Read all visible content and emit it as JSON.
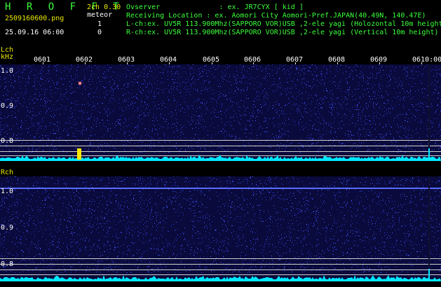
{
  "header": {
    "brand": "H R O F F T",
    "version": "2ch 0.30",
    "file_name": "2509160600.png",
    "datetime": "25.09.16 06:00",
    "meteor_label": "meteor",
    "meteor_lch": "1",
    "meteor_rch": "0",
    "observer_line": "Ovserver              : ex. JR7CYX [ kid ]",
    "location_line": "Receiving Location : ex. Aomori City Aomori-Pref.JAPAN(40.49N, 140.47E)",
    "lch_line": "L-ch:ex. UV5R 113.900Mhz(SAPPORO VOR)USB ,2-ele yagi (Holozontal 10m height)",
    "rch_line": "R-ch:ex. UV5R 113.900Mhz(SAPPORO VOR)USB ,2-ele yagi (Vertical 10m height)"
  },
  "time_axis": [
    "0601",
    "0602",
    "0603",
    "0604",
    "0605",
    "0606",
    "0607",
    "0608",
    "0609",
    "0610:00"
  ],
  "lch": {
    "label": "Lch",
    "unit": "kHz",
    "ticks": [
      "1.0",
      "0.9",
      "0.8"
    ]
  },
  "rch": {
    "label": "Rch",
    "ticks": [
      "1.0",
      "0.9",
      "0.8"
    ]
  },
  "colors": {
    "background": "#0a0a3c",
    "noise": "#2a38c8",
    "signal": "#00e8ff",
    "meteor": "#ffe800",
    "text_green": "#3cff3c",
    "text_yellow": "#e8e800"
  }
}
